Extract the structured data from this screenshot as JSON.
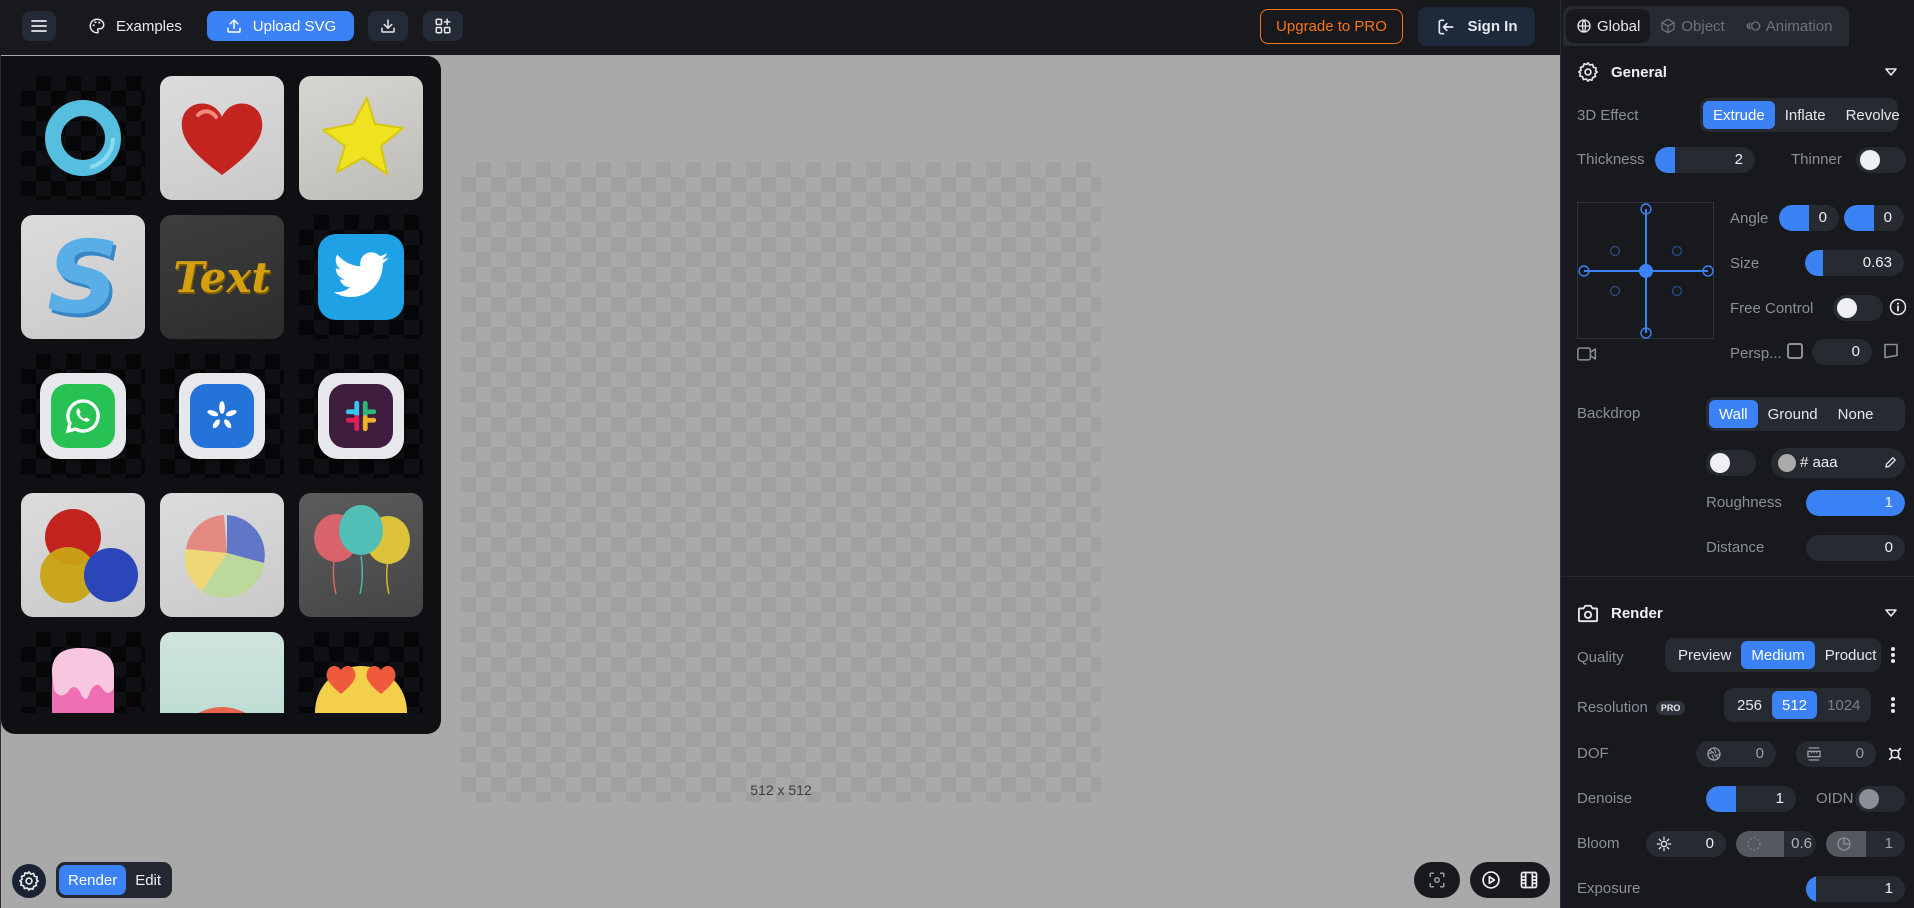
{
  "topbar": {
    "menu_icon": "hamburger-icon",
    "examples_label": "Examples",
    "upload_label": "Upload SVG",
    "download_icon": "download-icon",
    "add_widget_icon": "widgets-add-icon",
    "upgrade_label": "Upgrade to PRO",
    "signin_label": "Sign In"
  },
  "colors": {
    "accent": "#3b82f6",
    "upgrade": "#f97316",
    "panel_bg": "#17191d",
    "control_bg": "#262a31",
    "stage_bg": "#a9a9a9"
  },
  "examples": {
    "items": [
      {
        "name": "torus-ring",
        "bg": "checker"
      },
      {
        "name": "glass-heart",
        "bg": "light"
      },
      {
        "name": "yellow-star",
        "bg": "gray"
      },
      {
        "name": "letter-s",
        "bg": "light"
      },
      {
        "name": "gold-text",
        "bg": "dark",
        "text": "Text"
      },
      {
        "name": "twitter-logo",
        "bg": "checker"
      },
      {
        "name": "whatsapp-app",
        "bg": "checker"
      },
      {
        "name": "yelp-app",
        "bg": "checker"
      },
      {
        "name": "slack-app",
        "bg": "checker"
      },
      {
        "name": "color-discs",
        "bg": "light"
      },
      {
        "name": "pie-chart",
        "bg": "light"
      },
      {
        "name": "balloons",
        "bg": "dark"
      },
      {
        "name": "popsicle",
        "bg": "checker"
      },
      {
        "name": "rainbow",
        "bg": "mint"
      },
      {
        "name": "heart-eyes-emoji",
        "bg": "checker"
      }
    ]
  },
  "canvas": {
    "size_label": "512 x 512"
  },
  "bottom": {
    "mode_options": [
      "Render",
      "Edit"
    ],
    "mode_selected": "Render"
  },
  "panel": {
    "tabs": [
      {
        "label": "Global",
        "icon": "globe-icon",
        "active": true
      },
      {
        "label": "Object",
        "icon": "cube-icon",
        "active": false
      },
      {
        "label": "Animation",
        "icon": "animation-icon",
        "active": false
      }
    ],
    "general": {
      "title": "General",
      "effect_label": "3D Effect",
      "effect_options": [
        "Extrude",
        "Inflate",
        "Revolve"
      ],
      "effect_selected": "Extrude",
      "thickness_label": "Thickness",
      "thickness_value": "2",
      "thickness_fill": 0.2,
      "thinner_label": "Thinner",
      "thinner_on": false,
      "angle_label": "Angle",
      "angle_x": "0",
      "angle_y": "0",
      "angle_fill": 0.5,
      "size_label": "Size",
      "size_value": "0.63",
      "size_fill": 0.18,
      "free_control_label": "Free Control",
      "free_control_on": false,
      "persp_label": "Persp...",
      "persp_checked": false,
      "persp_value": "0",
      "backdrop_label": "Backdrop",
      "backdrop_options": [
        "Wall",
        "Ground",
        "None"
      ],
      "backdrop_selected": "Wall",
      "backdrop_toggle_on": false,
      "backdrop_color": "# aaa",
      "backdrop_color_hex": "#aaaaaa",
      "roughness_label": "Roughness",
      "roughness_value": "1",
      "roughness_fill": 1.0,
      "distance_label": "Distance",
      "distance_value": "0",
      "distance_fill": 0
    },
    "render": {
      "title": "Render",
      "quality_label": "Quality",
      "quality_options": [
        "Preview",
        "Medium",
        "Product"
      ],
      "quality_selected": "Medium",
      "resolution_label": "Resolution",
      "resolution_badge": "PRO",
      "resolution_options": [
        "256",
        "512",
        "1024"
      ],
      "resolution_selected": "512",
      "dof_label": "DOF",
      "dof_aperture": "0",
      "dof_distance": "0",
      "denoise_label": "Denoise",
      "denoise_value": "1",
      "denoise_fill": 0.33,
      "oidn_label": "OIDN",
      "oidn_on": false,
      "bloom_label": "Bloom",
      "bloom_intensity": "0",
      "bloom_radius": "0.6",
      "bloom_threshold": "1",
      "exposure_label": "Exposure",
      "exposure_value": "1",
      "exposure_fill": 0.1
    }
  }
}
